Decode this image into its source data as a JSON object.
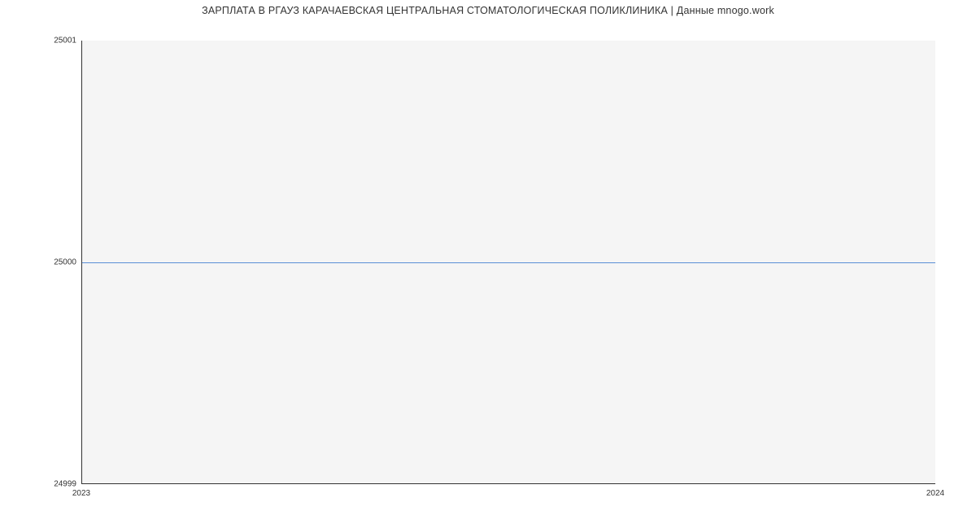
{
  "chart_data": {
    "type": "line",
    "title": "ЗАРПЛАТА В РГАУЗ КАРАЧАЕВСКАЯ ЦЕНТРАЛЬНАЯ СТОМАТОЛОГИЧЕСКАЯ ПОЛИКЛИНИКА | Данные mnogo.work",
    "xlabel": "",
    "ylabel": "",
    "x": [
      2023,
      2024
    ],
    "values": [
      25000,
      25000
    ],
    "ylim": [
      24999,
      25001
    ],
    "xlim": [
      2023,
      2024
    ],
    "y_ticks": [
      24999,
      25000,
      25001
    ],
    "x_ticks": [
      2023,
      2024
    ],
    "line_color": "#5b8fd6"
  },
  "ticks": {
    "y_top": "25001",
    "y_mid": "25000",
    "y_bot": "24999",
    "x_left": "2023",
    "x_right": "2024"
  }
}
